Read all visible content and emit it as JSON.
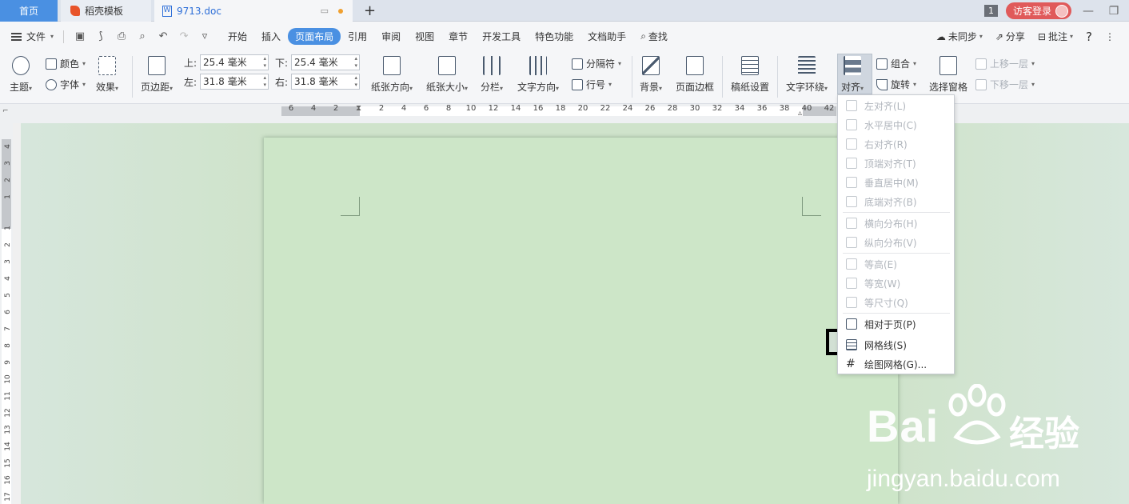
{
  "tabs": {
    "home": "首页",
    "template": "稻壳模板",
    "doc": "9713.doc",
    "add": "+"
  },
  "titlebar_right": {
    "count": "1",
    "login": "访客登录"
  },
  "menubar": {
    "file": "文件",
    "items": [
      "开始",
      "插入",
      "页面布局",
      "引用",
      "审阅",
      "视图",
      "章节",
      "开发工具",
      "特色功能",
      "文档助手"
    ],
    "active": "页面布局",
    "search": "查找",
    "sync": "未同步",
    "share": "分享",
    "comment": "批注",
    "help": "?"
  },
  "ribbon": {
    "theme": "主题",
    "color": "颜色",
    "font": "字体",
    "effect": "效果",
    "margins": "页边距",
    "top_label": "上:",
    "top_value": "25.4 毫米",
    "bottom_label": "下:",
    "bottom_value": "25.4 毫米",
    "left_label": "左:",
    "left_value": "31.8 毫米",
    "right_label": "右:",
    "right_value": "31.8 毫米",
    "orientation": "纸张方向",
    "size": "纸张大小",
    "columns": "分栏",
    "text_direction": "文字方向",
    "breaks": "分隔符",
    "line_numbers": "行号",
    "background": "背景",
    "page_border": "页面边框",
    "manuscript": "稿纸设置",
    "wrap": "文字环绕",
    "align": "对齐",
    "group": "组合",
    "rotate": "旋转",
    "selection_pane": "选择窗格",
    "bring_forward": "上移一层",
    "send_backward": "下移一层"
  },
  "ruler": {
    "h_numbers": [
      "6",
      "4",
      "2",
      "2",
      "4",
      "6",
      "8",
      "10",
      "12",
      "14",
      "16",
      "18",
      "20",
      "22",
      "24",
      "26",
      "28",
      "30",
      "32",
      "34",
      "36",
      "38",
      "40",
      "42"
    ],
    "v_numbers": [
      "4",
      "3",
      "2",
      "1",
      "1",
      "2",
      "3",
      "4",
      "5",
      "6",
      "7",
      "8",
      "9",
      "10",
      "11",
      "12",
      "13",
      "14",
      "15",
      "16",
      "17"
    ]
  },
  "align_menu": {
    "items": [
      {
        "label": "左对齐(L)",
        "enabled": false
      },
      {
        "label": "水平居中(C)",
        "enabled": false
      },
      {
        "label": "右对齐(R)",
        "enabled": false
      },
      {
        "label": "顶端对齐(T)",
        "enabled": false
      },
      {
        "label": "垂直居中(M)",
        "enabled": false
      },
      {
        "label": "底端对齐(B)",
        "enabled": false
      },
      {
        "label": "横向分布(H)",
        "enabled": false
      },
      {
        "label": "纵向分布(V)",
        "enabled": false
      },
      {
        "label": "等高(E)",
        "enabled": false
      },
      {
        "label": "等宽(W)",
        "enabled": false
      },
      {
        "label": "等尺寸(Q)",
        "enabled": false
      },
      {
        "label": "相对于页(P)",
        "enabled": true
      },
      {
        "label": "网格线(S)",
        "enabled": true
      },
      {
        "label": "绘图网格(G)...",
        "enabled": true
      }
    ],
    "highlighted": "网格线(S)"
  },
  "watermark": {
    "logo": "Bai",
    "logo_cn": "经验",
    "url": "jingyan.baidu.com"
  },
  "colors": {
    "accent": "#4a90e2",
    "login": "#e05a5a",
    "page": "#cde6c8",
    "workspace": "#cfe3cb"
  }
}
